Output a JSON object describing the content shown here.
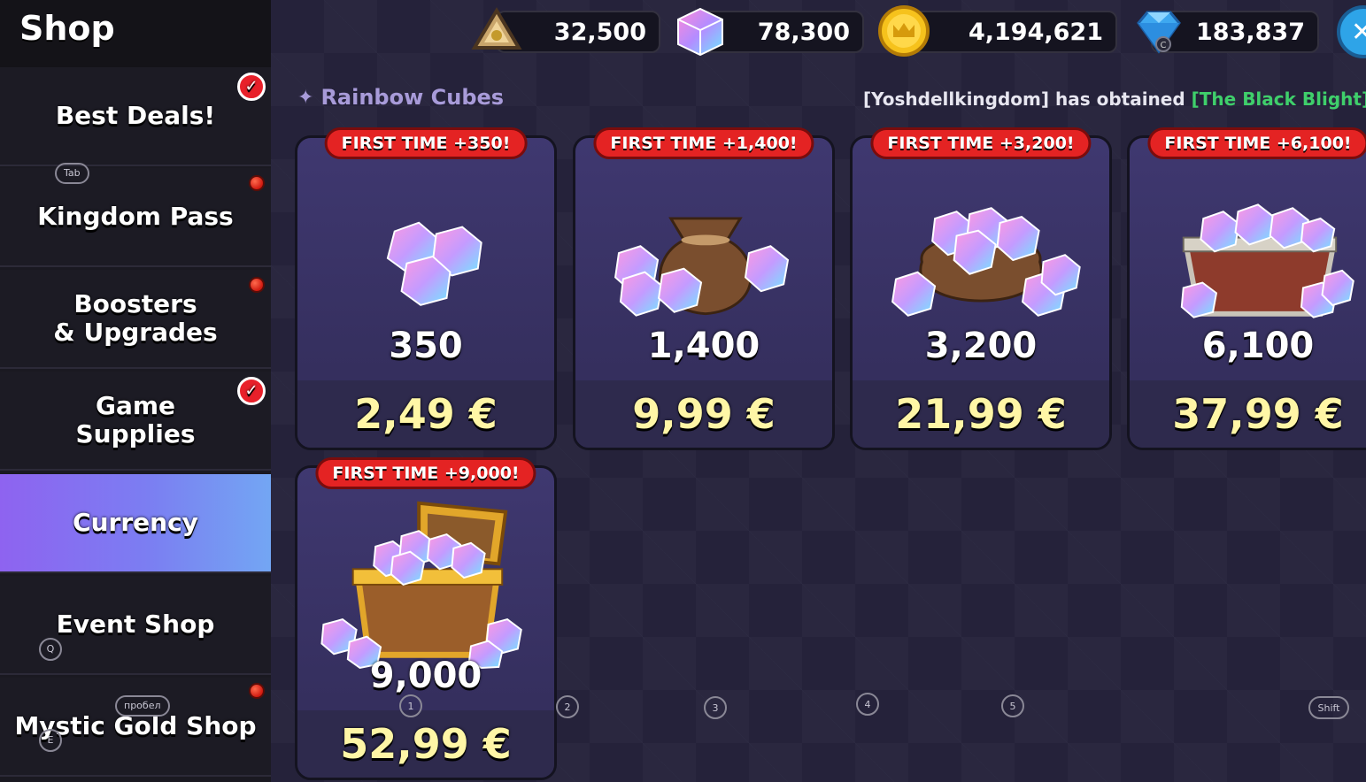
{
  "sidebar": {
    "title": "Shop",
    "items": [
      {
        "label": "Best Deals!",
        "badge": "check"
      },
      {
        "label": "Kingdom Pass",
        "badge": "dot",
        "hint": "Tab"
      },
      {
        "label": "Boosters\n& Upgrades",
        "badge": "dot"
      },
      {
        "label": "Game\nSupplies",
        "badge": "check"
      },
      {
        "label": "Currency",
        "active": true
      },
      {
        "label": "Event Shop",
        "hint": "Q"
      },
      {
        "label": "Mystic Gold Shop",
        "badge": "dot",
        "hint": "пробел",
        "hint2": "E"
      }
    ]
  },
  "currencies": [
    {
      "icon": "stamina-icon",
      "value": "32,500"
    },
    {
      "icon": "rainbow-cube-icon",
      "value": "78,300"
    },
    {
      "icon": "gold-crown-coin-icon",
      "value": "4,194,621"
    },
    {
      "icon": "crystal-icon",
      "value": "183,837",
      "key": "C"
    }
  ],
  "section": {
    "title": "Rainbow Cubes"
  },
  "ticker": {
    "player": "[Yoshdellkingdom]",
    "text": " has obtained ",
    "item": "[The Black Blight]"
  },
  "products": [
    {
      "ribbon": "FIRST TIME +350!",
      "amount": "350",
      "price": "2,49 €",
      "art": "cubes-small",
      "key": "1"
    },
    {
      "ribbon": "FIRST TIME +1,400!",
      "amount": "1,400",
      "price": "9,99 €",
      "art": "bag-small",
      "key": "2"
    },
    {
      "ribbon": "FIRST TIME +3,200!",
      "amount": "3,200",
      "price": "21,99 €",
      "art": "bag-large",
      "key": "3"
    },
    {
      "ribbon": "FIRST TIME +6,100!",
      "amount": "6,100",
      "price": "37,99 €",
      "art": "chest",
      "key": "4"
    },
    {
      "ribbon": "FIRST TIME +9,000!",
      "amount": "9,000",
      "price": "52,99 €",
      "art": "gold-chest",
      "key": "5"
    }
  ],
  "keys": {
    "shift": "Shift"
  },
  "colors": {
    "active_tab_start": "#8e63f0",
    "active_tab_end": "#73a6f3",
    "price": "#fff6a6",
    "ribbon": "#e42323",
    "ticker_item": "#3fcf6b"
  }
}
